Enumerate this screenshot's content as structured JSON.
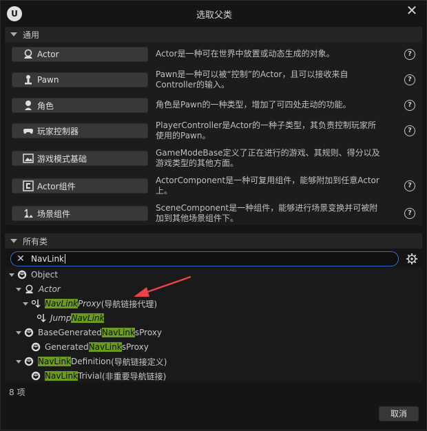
{
  "window": {
    "title": "选取父类",
    "close_symbol": "✕",
    "logo_letter": "U"
  },
  "common": {
    "header": "通用",
    "items": [
      {
        "label": "Actor",
        "icon": "actor-icon",
        "desc": [
          "Actor是一种可在世界中放置或动态生成的对象。"
        ]
      },
      {
        "label": "Pawn",
        "icon": "pawn-icon",
        "desc": [
          "Pawn是一种可以被“控制”的Actor，且可以接收来自",
          "Controller的输入。"
        ]
      },
      {
        "label": "角色",
        "icon": "character-icon",
        "desc": [
          "角色是Pawn的一种类型，增加了可四处走动的功能。"
        ]
      },
      {
        "label": "玩家控制器",
        "icon": "gamepad-icon",
        "desc": [
          "PlayerController是Actor的一种子类型，其负责控制玩家所",
          "使用的Pawn。"
        ]
      },
      {
        "label": "游戏模式基础",
        "icon": "game-mode-icon",
        "desc": [
          "GameModeBase定义了正在进行的游戏、其规则、得分以及",
          "游戏类型的其他方面。"
        ]
      },
      {
        "label": "Actor组件",
        "icon": "actor-component-icon",
        "desc": [
          "ActorComponent是一种可复用组件，能够附加到任意Actor",
          "上。"
        ]
      },
      {
        "label": "场景组件",
        "icon": "scene-component-icon",
        "desc": [
          "SceneComponent是一种组件，能够进行场景变换并可被附",
          "加到其他场景组件下。"
        ]
      }
    ],
    "help_symbol": "?"
  },
  "all_classes": {
    "header": "所有类",
    "search_value": "NavLink",
    "clear_symbol": "✕",
    "tree": [
      {
        "pre": "Object",
        "hl": "",
        "post": "",
        "suffix": ""
      },
      {
        "pre": "Actor",
        "hl": "",
        "post": "",
        "suffix": ""
      },
      {
        "pre": "",
        "hl": "NavLink",
        "post": "Proxy",
        "suffix": " (导航链接代理)"
      },
      {
        "pre": "Jump",
        "hl": "NavLink",
        "post": "",
        "suffix": ""
      },
      {
        "pre": "BaseGenerated",
        "hl": "NavLink",
        "post": "sProxy",
        "suffix": ""
      },
      {
        "pre": "Generated",
        "hl": "NavLink",
        "post": "sProxy",
        "suffix": ""
      },
      {
        "pre": "",
        "hl": "NavLink",
        "post": "Definition",
        "suffix": " (导航链接定义)"
      },
      {
        "pre": "",
        "hl": "NavLink",
        "post": "Trivial",
        "suffix": " (非重要导航链接)"
      }
    ],
    "count": "8 项"
  },
  "footer": {
    "cancel_label": "取消"
  },
  "colors": {
    "highlight": "#6a9a1f",
    "search_border": "#2f6fd0",
    "arrow": "#e8434a"
  }
}
